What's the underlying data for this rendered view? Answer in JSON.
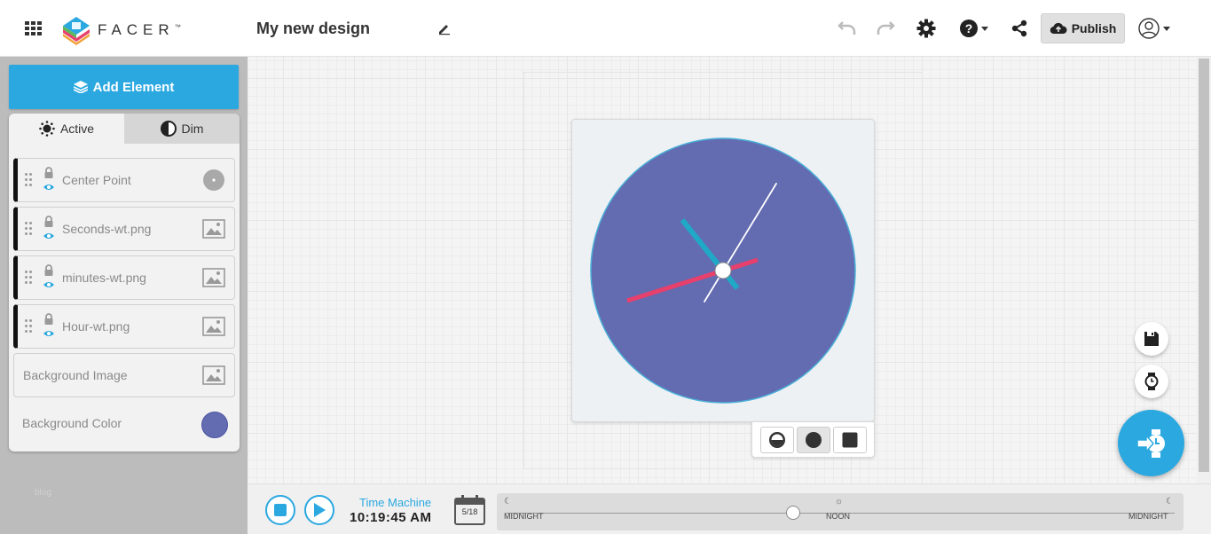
{
  "header": {
    "logo_text": "FACER",
    "logo_tm": "™",
    "design_title": "My new design",
    "publish_label": "Publish"
  },
  "sidebar": {
    "add_element_label": "Add Element",
    "tabs": [
      {
        "label": "Active"
      },
      {
        "label": "Dim"
      }
    ],
    "layers": [
      {
        "label": "Center Point",
        "thumb": "circle-dot-icon"
      },
      {
        "label": "Seconds-wt.png",
        "thumb": "image-icon"
      },
      {
        "label": "minutes-wt.png",
        "thumb": "image-icon"
      },
      {
        "label": "Hour-wt.png",
        "thumb": "image-icon"
      }
    ],
    "background_image_label": "Background Image",
    "background_color_label": "Background Color",
    "background_color": "#636bb1",
    "blog_link": "blog"
  },
  "watch": {
    "face_color": "#636bb1",
    "rim_color": "#4ab0d8",
    "hour_hand_color": "#e8406c",
    "minute_hand_color": "#1fa9c7",
    "second_hand_color": "#ffffff",
    "shape_options": [
      "round-preview",
      "round",
      "square"
    ],
    "selected_shape": "round"
  },
  "time_machine": {
    "label": "Time Machine",
    "time": "10:19:45 AM",
    "date": "5/18",
    "timeline_left": "MIDNIGHT",
    "timeline_center": "NOON",
    "timeline_right": "MIDNIGHT",
    "timeline_position": 0.43
  },
  "colors": {
    "accent": "#2ba8e0"
  }
}
